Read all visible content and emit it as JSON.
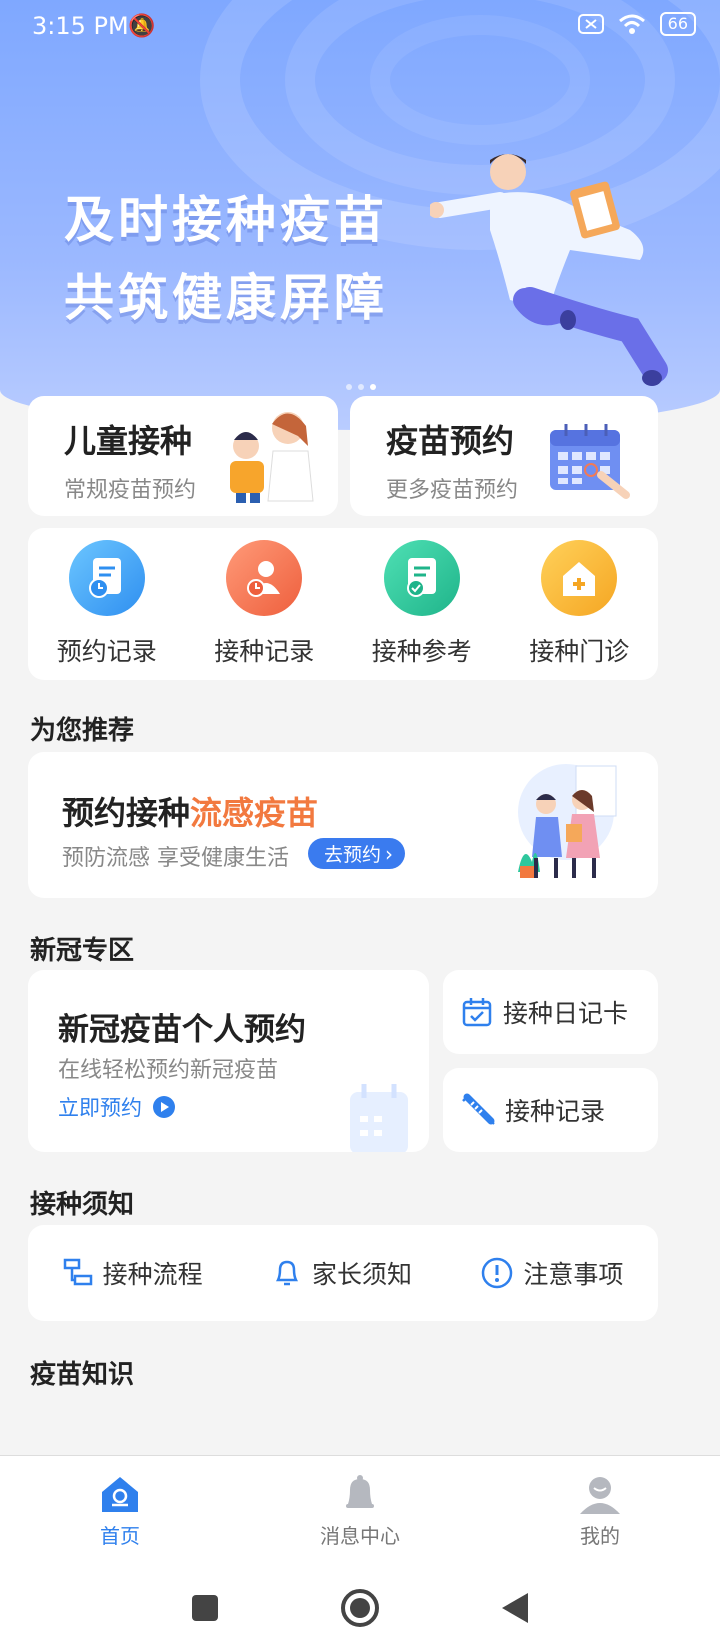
{
  "status_bar": {
    "time": "3:15 PM",
    "battery": "66"
  },
  "banner": {
    "line1": "及时接种疫苗",
    "line2": "共筑健康屏障"
  },
  "top_cards": [
    {
      "title": "儿童接种",
      "subtitle": "常规疫苗预约"
    },
    {
      "title": "疫苗预约",
      "subtitle": "更多疫苗预约"
    }
  ],
  "quick_actions": [
    {
      "label": "预约记录",
      "color": "#3aa6f5"
    },
    {
      "label": "接种记录",
      "color": "#f27a56"
    },
    {
      "label": "接种参考",
      "color": "#2ec79d"
    },
    {
      "label": "接种门诊",
      "color": "#f7b931"
    }
  ],
  "recommend": {
    "section_title": "为您推荐",
    "title_prefix": "预约接种",
    "title_highlight": "流感疫苗",
    "subtitle": "预防流感 享受健康生活",
    "button": "去预约"
  },
  "covid": {
    "section_title": "新冠专区",
    "main_title": "新冠疫苗个人预约",
    "main_subtitle": "在线轻松预约新冠疫苗",
    "main_link": "立即预约",
    "side_items": [
      "接种日记卡",
      "接种记录"
    ]
  },
  "notice": {
    "section_title": "接种须知",
    "items": [
      "接种流程",
      "家长须知",
      "注意事项"
    ]
  },
  "knowledge": {
    "section_title": "疫苗知识"
  },
  "tabbar": [
    {
      "label": "首页",
      "active": true
    },
    {
      "label": "消息中心",
      "active": false
    },
    {
      "label": "我的",
      "active": false
    }
  ],
  "colors": {
    "accent": "#2f80ed",
    "highlight": "#f2793f",
    "banner": "#8db0ff"
  }
}
